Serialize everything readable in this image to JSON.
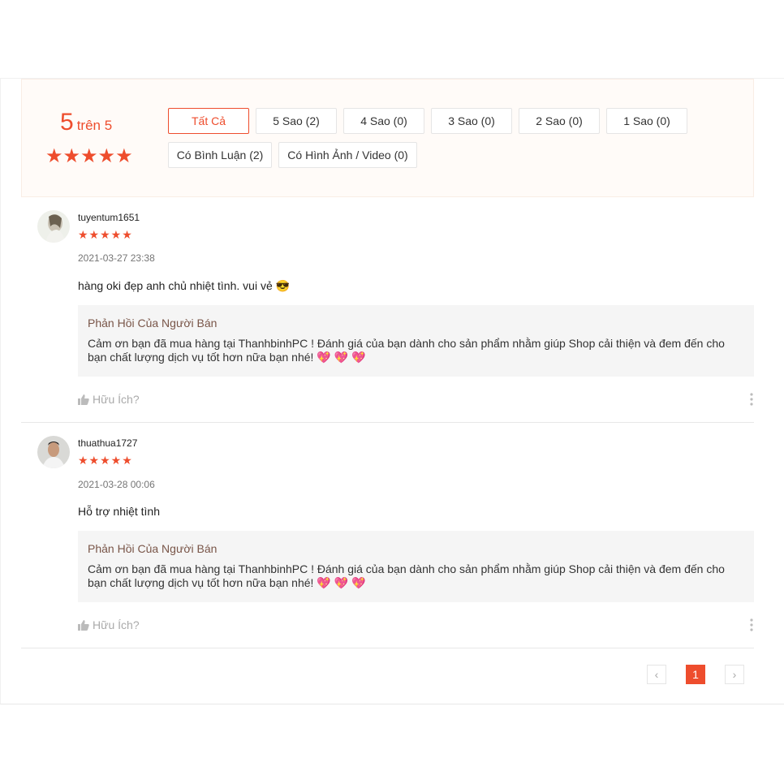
{
  "overview": {
    "score": "5",
    "score_suffix": "trên 5",
    "stars": "★★★★★",
    "filters": [
      {
        "label": "Tất Cả"
      },
      {
        "label": "5 Sao (2)"
      },
      {
        "label": "4 Sao (0)"
      },
      {
        "label": "3 Sao (0)"
      },
      {
        "label": "2 Sao (0)"
      },
      {
        "label": "1 Sao (0)"
      },
      {
        "label": "Có Bình Luận (2)"
      },
      {
        "label": "Có Hình Ảnh / Video (0)"
      }
    ]
  },
  "reviews": [
    {
      "username": "tuyentum1651",
      "stars": "★★★★★",
      "rating": 5,
      "date": "2021-03-27 23:38",
      "comment": "hàng oki  đẹp anh chủ nhiệt tình. vui vẻ",
      "emoji": "😎",
      "reply_title": "Phản Hồi Của Người Bán",
      "reply_text": "Cảm ơn bạn đã mua hàng tại ThanhbinhPC ! Đánh giá của bạn dành cho sản phẩm nhằm giúp Shop cải thiện và đem đến cho bạn chất lượng dịch vụ tốt hơn nữa bạn nhé!",
      "reply_hearts": "💖 💖 💖",
      "helpful_label": "Hữu Ích?"
    },
    {
      "username": "thuathua1727",
      "stars": "★★★★★",
      "rating": 5,
      "date": "2021-03-28 00:06",
      "comment": "Hỗ trợ nhiệt tình",
      "emoji": "",
      "reply_title": "Phản Hồi Của Người Bán",
      "reply_text": "Cảm ơn bạn đã mua hàng tại ThanhbinhPC ! Đánh giá của bạn dành cho sản phẩm nhằm giúp Shop cải thiện và đem đến cho bạn chất lượng dịch vụ tốt hơn nữa bạn nhé!",
      "reply_hearts": "💖 💖 💖",
      "helpful_label": "Hữu Ích?"
    }
  ],
  "pagination": {
    "prev": "‹",
    "current": "1",
    "next": "›"
  },
  "colors": {
    "accent": "#ee4d2d",
    "reply_title": "#795548"
  }
}
